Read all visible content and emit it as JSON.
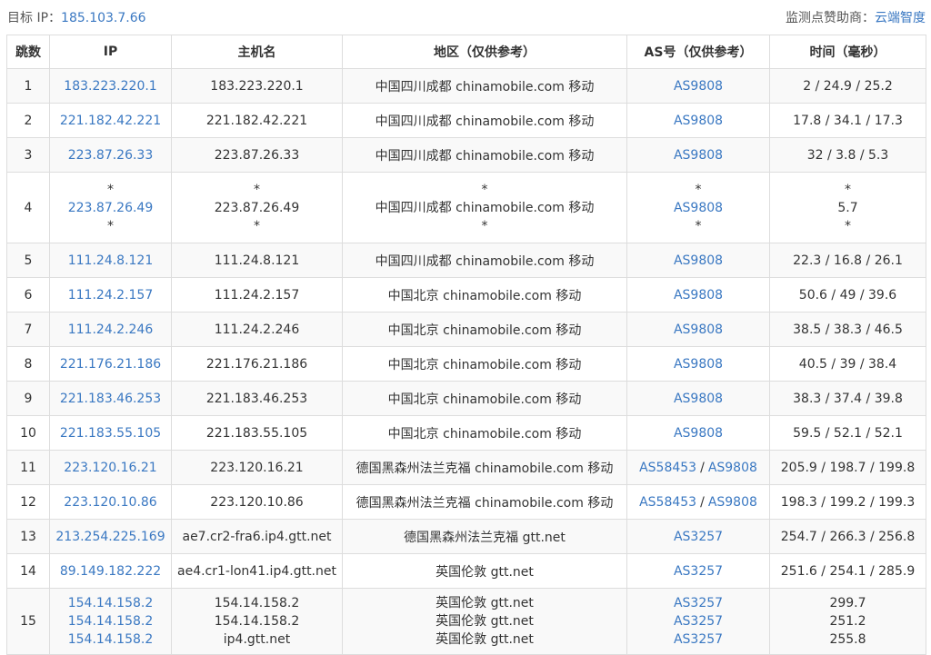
{
  "header": {
    "target_label": "目标 IP：",
    "target_ip": "185.103.7.66",
    "sponsor_label": "监测点赞助商：",
    "sponsor_name": "云端智度"
  },
  "columns": [
    "跳数",
    "IP",
    "主机名",
    "地区（仅供参考）",
    "AS号（仅供参考）",
    "时间（毫秒）"
  ],
  "rows": [
    {
      "hop": "1",
      "ip": [
        "183.223.220.1"
      ],
      "host": [
        "183.223.220.1"
      ],
      "region": [
        "中国四川成都 chinamobile.com 移动"
      ],
      "as": [
        [
          "AS9808"
        ]
      ],
      "time": [
        "2 / 24.9 / 25.2"
      ]
    },
    {
      "hop": "2",
      "ip": [
        "221.182.42.221"
      ],
      "host": [
        "221.182.42.221"
      ],
      "region": [
        "中国四川成都 chinamobile.com 移动"
      ],
      "as": [
        [
          "AS9808"
        ]
      ],
      "time": [
        "17.8 / 34.1 / 17.3"
      ]
    },
    {
      "hop": "3",
      "ip": [
        "223.87.26.33"
      ],
      "host": [
        "223.87.26.33"
      ],
      "region": [
        "中国四川成都 chinamobile.com 移动"
      ],
      "as": [
        [
          "AS9808"
        ]
      ],
      "time": [
        "32 / 3.8 / 5.3"
      ]
    },
    {
      "hop": "4",
      "ip": [
        "*",
        "223.87.26.49",
        "*"
      ],
      "host": [
        "*",
        "223.87.26.49",
        "*"
      ],
      "region": [
        "*",
        "中国四川成都 chinamobile.com 移动",
        "*"
      ],
      "as": [
        [
          "*"
        ],
        [
          "AS9808"
        ],
        [
          "*"
        ]
      ],
      "time": [
        "*",
        "5.7",
        "*"
      ]
    },
    {
      "hop": "5",
      "ip": [
        "111.24.8.121"
      ],
      "host": [
        "111.24.8.121"
      ],
      "region": [
        "中国四川成都 chinamobile.com 移动"
      ],
      "as": [
        [
          "AS9808"
        ]
      ],
      "time": [
        "22.3 / 16.8 / 26.1"
      ]
    },
    {
      "hop": "6",
      "ip": [
        "111.24.2.157"
      ],
      "host": [
        "111.24.2.157"
      ],
      "region": [
        "中国北京 chinamobile.com 移动"
      ],
      "as": [
        [
          "AS9808"
        ]
      ],
      "time": [
        "50.6 / 49 / 39.6"
      ]
    },
    {
      "hop": "7",
      "ip": [
        "111.24.2.246"
      ],
      "host": [
        "111.24.2.246"
      ],
      "region": [
        "中国北京 chinamobile.com 移动"
      ],
      "as": [
        [
          "AS9808"
        ]
      ],
      "time": [
        "38.5 / 38.3 / 46.5"
      ]
    },
    {
      "hop": "8",
      "ip": [
        "221.176.21.186"
      ],
      "host": [
        "221.176.21.186"
      ],
      "region": [
        "中国北京 chinamobile.com 移动"
      ],
      "as": [
        [
          "AS9808"
        ]
      ],
      "time": [
        "40.5 / 39 / 38.4"
      ]
    },
    {
      "hop": "9",
      "ip": [
        "221.183.46.253"
      ],
      "host": [
        "221.183.46.253"
      ],
      "region": [
        "中国北京 chinamobile.com 移动"
      ],
      "as": [
        [
          "AS9808"
        ]
      ],
      "time": [
        "38.3 / 37.4 / 39.8"
      ]
    },
    {
      "hop": "10",
      "ip": [
        "221.183.55.105"
      ],
      "host": [
        "221.183.55.105"
      ],
      "region": [
        "中国北京 chinamobile.com 移动"
      ],
      "as": [
        [
          "AS9808"
        ]
      ],
      "time": [
        "59.5 / 52.1 / 52.1"
      ]
    },
    {
      "hop": "11",
      "ip": [
        "223.120.16.21"
      ],
      "host": [
        "223.120.16.21"
      ],
      "region": [
        "德国黑森州法兰克福 chinamobile.com 移动"
      ],
      "as": [
        [
          "AS58453",
          "AS9808"
        ]
      ],
      "time": [
        "205.9 / 198.7 / 199.8"
      ]
    },
    {
      "hop": "12",
      "ip": [
        "223.120.10.86"
      ],
      "host": [
        "223.120.10.86"
      ],
      "region": [
        "德国黑森州法兰克福 chinamobile.com 移动"
      ],
      "as": [
        [
          "AS58453",
          "AS9808"
        ]
      ],
      "time": [
        "198.3 / 199.2 / 199.3"
      ]
    },
    {
      "hop": "13",
      "ip": [
        "213.254.225.169"
      ],
      "host": [
        "ae7.cr2-fra6.ip4.gtt.net"
      ],
      "region": [
        "德国黑森州法兰克福 gtt.net"
      ],
      "as": [
        [
          "AS3257"
        ]
      ],
      "time": [
        "254.7 / 266.3 / 256.8"
      ]
    },
    {
      "hop": "14",
      "ip": [
        "89.149.182.222"
      ],
      "host": [
        "ae4.cr1-lon41.ip4.gtt.net"
      ],
      "region": [
        "英国伦敦 gtt.net"
      ],
      "as": [
        [
          "AS3257"
        ]
      ],
      "time": [
        "251.6 / 254.1 / 285.9"
      ]
    },
    {
      "hop": "15",
      "ip": [
        "154.14.158.2",
        "154.14.158.2",
        "154.14.158.2"
      ],
      "host": [
        "154.14.158.2",
        "154.14.158.2",
        "ip4.gtt.net"
      ],
      "region": [
        "英国伦敦 gtt.net",
        "英国伦敦 gtt.net",
        "英国伦敦 gtt.net"
      ],
      "as": [
        [
          "AS3257"
        ],
        [
          "AS3257"
        ],
        [
          "AS3257"
        ]
      ],
      "time": [
        "299.7",
        "251.2",
        "255.8"
      ]
    }
  ]
}
